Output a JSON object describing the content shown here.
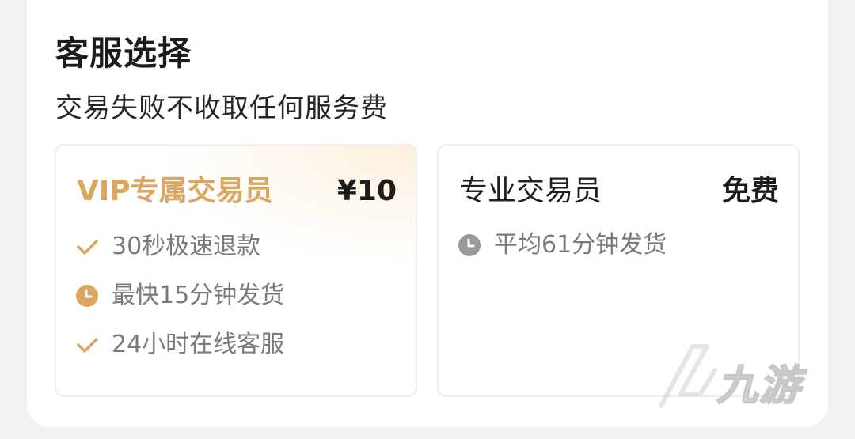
{
  "section": {
    "title": "客服选择",
    "subtitle": "交易失败不收取任何服务费"
  },
  "cards": [
    {
      "name": "VIP专属交易员",
      "price": "¥10",
      "features": [
        {
          "icon": "check-icon",
          "text": "30秒极速退款"
        },
        {
          "icon": "clock-icon",
          "text": "最快15分钟发货"
        },
        {
          "icon": "check-icon",
          "text": "24小时在线客服"
        }
      ]
    },
    {
      "name": "专业交易员",
      "price": "免费",
      "features": [
        {
          "icon": "clock-icon",
          "text": "平均61分钟发货"
        }
      ]
    }
  ],
  "watermark": {
    "text": "九游"
  },
  "colors": {
    "vip_accent": "#dba660",
    "grey_icon": "#9a9a9a",
    "text_dark": "#1c1c1c",
    "text_muted": "#7a7a7a"
  }
}
